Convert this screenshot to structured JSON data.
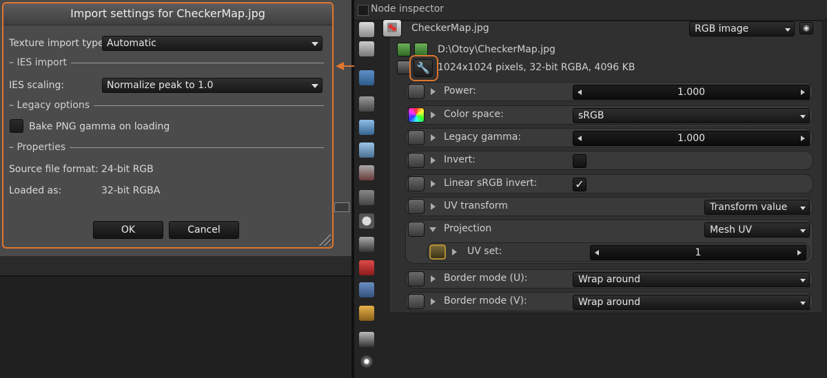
{
  "dialog": {
    "title": "Import settings for CheckerMap.jpg",
    "texture_import_type_label": "Texture import type:",
    "texture_import_type_value": "Automatic",
    "ies_section": "– IES import",
    "ies_scaling_label": "IES scaling:",
    "ies_scaling_value": "Normalize peak to 1.0",
    "legacy_section": "– Legacy options",
    "bake_png_label": "Bake PNG gamma on loading",
    "bake_png_checked": false,
    "properties_section": "– Properties",
    "source_format_label": "Source file format:",
    "source_format_value": "24-bit RGB",
    "loaded_as_label": "Loaded as:",
    "loaded_as_value": "32-bit RGBA",
    "ok_label": "OK",
    "cancel_label": "Cancel"
  },
  "inspector": {
    "header_title": "Node inspector",
    "node_name": "CheckerMap.jpg",
    "node_type": "RGB image",
    "file_path": "D:\\Otoy\\CheckerMap.jpg",
    "file_info": "1024x1024 pixels, 32-bit RGBA, 4096 KB",
    "params": {
      "power": {
        "label": "Power:",
        "value": "1.000"
      },
      "color_space": {
        "label": "Color space:",
        "value": "sRGB"
      },
      "legacy_gamma": {
        "label": "Legacy gamma:",
        "value": "1.000"
      },
      "invert": {
        "label": "Invert:",
        "checked": false
      },
      "linear_srgb_invert": {
        "label": "Linear sRGB invert:",
        "checked": true,
        "mark": "✓"
      },
      "uv_transform": {
        "label": "UV transform",
        "value": "Transform value"
      },
      "projection": {
        "label": "Projection",
        "value": "Mesh UV"
      },
      "uv_set": {
        "label": "UV set:",
        "value": "1"
      },
      "border_u": {
        "label": "Border mode (U):",
        "value": "Wrap around"
      },
      "border_v": {
        "label": "Border mode (V):",
        "value": "Wrap around"
      }
    }
  },
  "colors": {
    "highlight": "#e2762d",
    "panel": "#303030",
    "dialog_bg": "#4b4b4b"
  },
  "icons": {
    "wrench": "wrench-icon",
    "eye": "eye-icon"
  }
}
